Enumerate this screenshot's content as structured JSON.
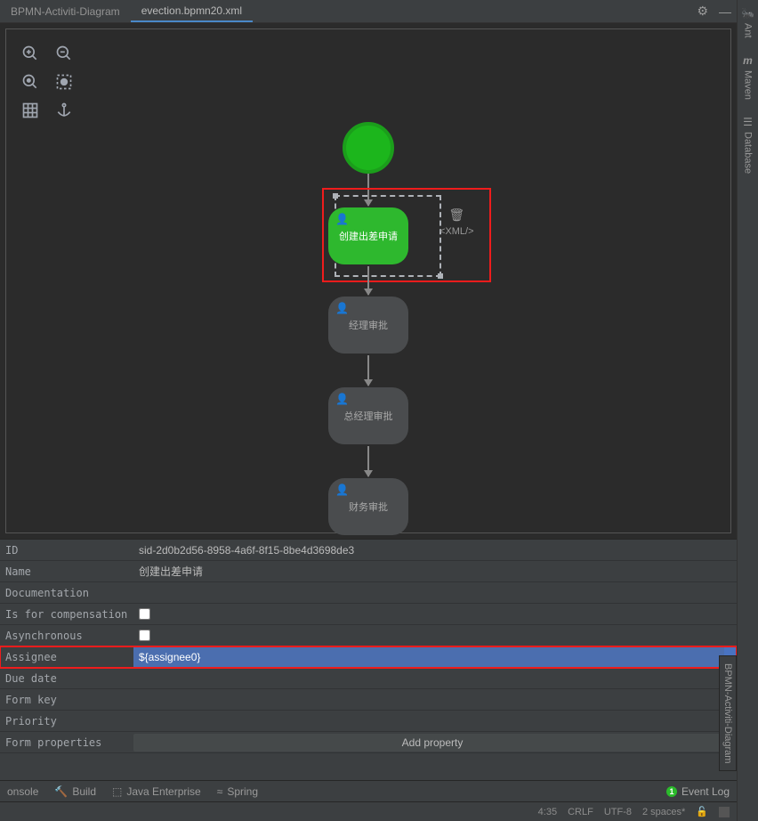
{
  "tabs": {
    "left": "BPMN-Activiti-Diagram",
    "right": "evection.bpmn20.xml"
  },
  "nodes": {
    "task1": "创建出差申请",
    "task2": "经理审批",
    "task3": "总经理审批",
    "task4": "财务审批",
    "xml_badge": "<XML/>"
  },
  "props": {
    "id_label": "ID",
    "id_val": "sid-2d0b2d56-8958-4a6f-8f15-8be4d3698de3",
    "name_label": "Name",
    "name_val": "创建出差申请",
    "doc_label": "Documentation",
    "comp_label": "Is for compensation",
    "async_label": "Asynchronous",
    "assignee_label": "Assignee",
    "assignee_val": "${assignee0}",
    "due_label": "Due date",
    "formkey_label": "Form key",
    "prio_label": "Priority",
    "formprops_label": "Form properties",
    "add_prop": "Add property"
  },
  "footer": {
    "console": "onsole",
    "build": "Build",
    "java_ee": "Java Enterprise",
    "spring": "Spring",
    "event_log": "Event Log",
    "notif_count": "1",
    "pos": "4:35",
    "line_sep": "CRLF",
    "encoding": "UTF-8",
    "indent": "2 spaces*"
  },
  "sidebar": {
    "ant": "Ant",
    "maven": "Maven",
    "db": "Database",
    "bpmn": "BPMN-Activiti-Diagram"
  }
}
